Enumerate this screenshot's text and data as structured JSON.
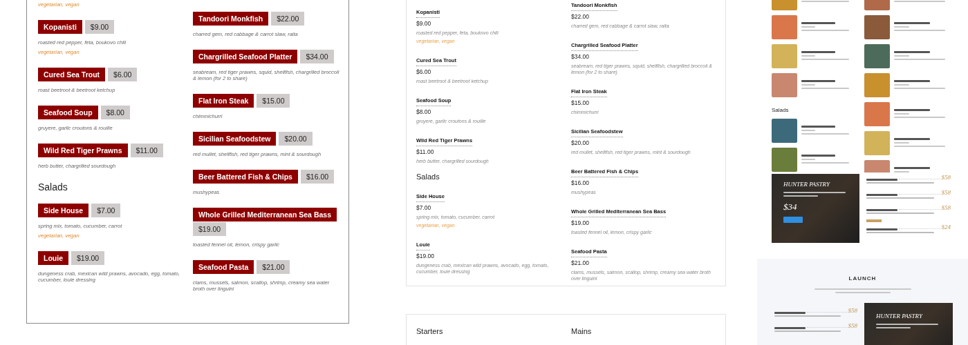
{
  "bordered_menu": {
    "columns": [
      [
        {
          "kind": "tags",
          "tags": "vegetarian, vegan"
        },
        {
          "kind": "item",
          "name": "Kopanisti",
          "price": "$9.00",
          "description": "roasted red pepper, feta, boukovo chili",
          "tags": "vegetarian, vegan"
        },
        {
          "kind": "item",
          "name": "Cured Sea Trout",
          "price": "$6.00",
          "description": "roast beetroot & beetroot ketchup"
        },
        {
          "kind": "item",
          "name": "Seafood Soup",
          "price": "$8.00",
          "description": "gruyere, garlic croutons & rouille"
        },
        {
          "kind": "item",
          "name": "Wild Red Tiger Prawns",
          "price": "$11.00",
          "description": "herb butter, chargrilled sourdough"
        },
        {
          "kind": "heading",
          "text": "Salads"
        },
        {
          "kind": "item",
          "name": "Side House",
          "price": "$7.00",
          "description": "spring mix, tomato, cucumber, carrot",
          "tags": "vegetarian, vegan"
        },
        {
          "kind": "item",
          "name": "Louie",
          "price": "$19.00",
          "description": "dungeness crab, mexican wild prawns, avocado, egg, tomato, cucumber, louie dressing"
        }
      ],
      [
        {
          "kind": "item",
          "name": "Tandoori Monkfish",
          "price": "$22.00",
          "description": "charred gem, red cabbage & carrot slaw, raita"
        },
        {
          "kind": "item",
          "name": "Chargrilled Seafood Platter",
          "price": "$34.00",
          "description": "seabream, red tiger prawns, squid, shellfish, chargrilled broccoli & lemon (for 2 to share)"
        },
        {
          "kind": "item",
          "name": "Flat Iron Steak",
          "price": "$15.00",
          "description": "chimmichurri"
        },
        {
          "kind": "item",
          "name": "Sicilian Seafoodstew",
          "price": "$20.00",
          "description": "red mullet, shellfish, red tiger prawns, mint & sourdough"
        },
        {
          "kind": "item",
          "name": "Beer Battered Fish & Chips",
          "price": "$16.00",
          "description": "mushypeas"
        },
        {
          "kind": "item",
          "name": "Whole Grilled Mediterranean Sea Bass",
          "price": "$19.00",
          "description": "toasted fennel oil, lemon, crispy garlic"
        },
        {
          "kind": "item",
          "name": "Seafood Pasta",
          "price": "$21.00",
          "description": "clams, mussels, salmon, scallop, shrimp, creamy sea water broth over linguini"
        }
      ]
    ]
  },
  "dotted_menu": {
    "columns": [
      [
        {
          "kind": "item",
          "name": "Kopanisti",
          "price": "$9.00",
          "description": "roasted red pepper, feta, boukovo chili",
          "tags": "vegetarian, vegan"
        },
        {
          "kind": "item",
          "name": "Cured Sea Trout",
          "price": "$6.00",
          "description": "roast beetroot & beetroot ketchup"
        },
        {
          "kind": "item",
          "name": "Seafood Soup",
          "price": "$8.00",
          "description": "gruyere, garlic croutons & rouille"
        },
        {
          "kind": "item",
          "name": "Wild Red Tiger Prawns",
          "price": "$11.00",
          "description": "herb butter, chargrilled sourdough"
        },
        {
          "kind": "heading",
          "text": "Salads"
        },
        {
          "kind": "item",
          "name": "Side House",
          "price": "$7.00",
          "description": "spring mix, tomato, cucumber, carrot",
          "tags": "vegetarian, vegan"
        },
        {
          "kind": "item",
          "name": "Louie",
          "price": "$19.00",
          "description": "dungeness crab, mexican wild prawns, avocado, egg, tomato, cucumber, louie dressing"
        }
      ],
      [
        {
          "kind": "item",
          "name": "Tandoori Monkfish",
          "price": "$22.00",
          "description": "charred gem, red cabbage & carrot slaw, raita"
        },
        {
          "kind": "item",
          "name": "Chargrilled Seafood Platter",
          "price": "$34.00",
          "description": "seabream, red tiger prawns, squid, shellfish, chargrilled broccoli & lemon (for 2 to share)"
        },
        {
          "kind": "item",
          "name": "Flat Iron Steak",
          "price": "$15.00",
          "description": "chimmichurri"
        },
        {
          "kind": "item",
          "name": "Sicilian Seafoodstew",
          "price": "$20.00",
          "description": "red mullet, shellfish, red tiger prawns, mint & sourdough"
        },
        {
          "kind": "item",
          "name": "Beer Battered Fish & Chips",
          "price": "$16.00",
          "description": "mushypeas"
        },
        {
          "kind": "item",
          "name": "Whole Grilled Mediterranean Sea Bass",
          "price": "$19.00",
          "description": "toasted fennel oil, lemon, crispy garlic"
        },
        {
          "kind": "item",
          "name": "Seafood Pasta",
          "price": "$21.00",
          "description": "clams, mussels, salmon, scallop, shrimp, creamy sea water broth over linguini"
        }
      ]
    ],
    "next_card_headings": [
      "Starters",
      "Mains"
    ]
  },
  "photo_menu": {
    "columns": [
      [
        {
          "kind": "item"
        },
        {
          "kind": "item"
        },
        {
          "kind": "item"
        },
        {
          "kind": "item"
        },
        {
          "kind": "heading",
          "text": "Salads"
        },
        {
          "kind": "item"
        },
        {
          "kind": "item"
        }
      ],
      [
        {
          "kind": "item"
        },
        {
          "kind": "item"
        },
        {
          "kind": "item"
        },
        {
          "kind": "item"
        },
        {
          "kind": "item"
        },
        {
          "kind": "item"
        },
        {
          "kind": "item"
        }
      ]
    ]
  },
  "promo": {
    "card": {
      "title": "HUNTER PASTRY",
      "price": "$34"
    },
    "items": [
      {
        "price": "$58",
        "flagged": false
      },
      {
        "price": "$58",
        "flagged": false
      },
      {
        "price": "$58",
        "flagged": false
      },
      {
        "price": "$24",
        "flagged": true
      }
    ]
  },
  "launch": {
    "title": "LAUNCH",
    "items": [
      {
        "price": "$58"
      },
      {
        "price": "$58"
      }
    ],
    "card": {
      "title": "HUNTER PASTRY"
    }
  }
}
